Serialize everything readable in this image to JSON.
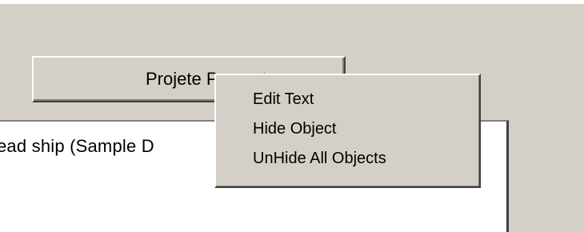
{
  "window": {
    "button_label": "Projete Proposta",
    "text_line": "ead ship (Sample D"
  },
  "context_menu": {
    "items": [
      {
        "label": "Edit Text"
      },
      {
        "label": "Hide Object"
      },
      {
        "label": "UnHide All Objects"
      }
    ]
  }
}
